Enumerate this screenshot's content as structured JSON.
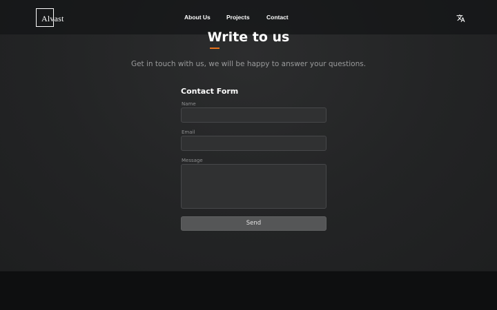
{
  "header": {
    "logo_text": "Alvast",
    "nav": [
      {
        "label": "About Us"
      },
      {
        "label": "Projects"
      },
      {
        "label": "Contact"
      }
    ],
    "translate_icon": "translate-icon"
  },
  "section": {
    "title": "Write to us",
    "subtitle": "Get in touch with us, we will be happy to answer your questions.",
    "accent_color": "#e8731c"
  },
  "form": {
    "title": "Contact Form",
    "name_label": "Name",
    "name_value": "",
    "email_label": "Email",
    "email_value": "",
    "message_label": "Message",
    "message_value": "",
    "send_label": "Send"
  }
}
